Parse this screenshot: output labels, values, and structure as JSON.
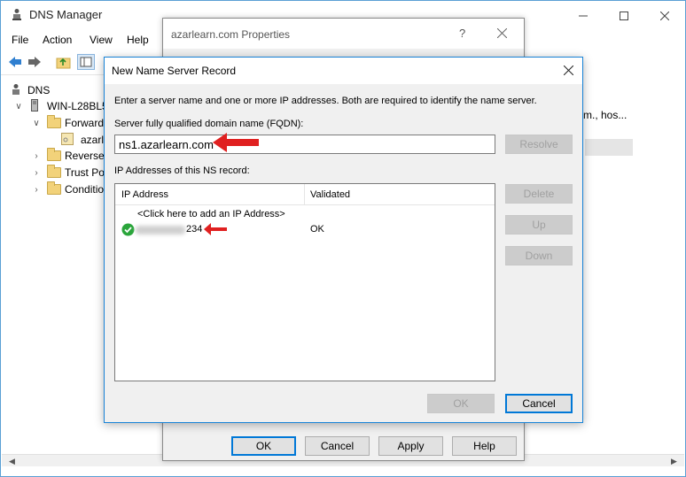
{
  "main_window": {
    "title": "DNS Manager",
    "menu": [
      "File",
      "Action",
      "View",
      "Help"
    ],
    "tree": {
      "root": "DNS",
      "server": "WIN-L28BL5",
      "forward": "Forward",
      "zone": "azarl",
      "reverse": "Reverse",
      "trust": "Trust Po",
      "conditional": "Conditio"
    },
    "right_pane_text": "m., hos..."
  },
  "properties_dialog": {
    "title": "azarlearn.com Properties",
    "help_glyph": "?",
    "buttons": {
      "ok": "OK",
      "cancel": "Cancel",
      "apply": "Apply",
      "help": "Help"
    }
  },
  "ns_dialog": {
    "title": "New Name Server Record",
    "instructions": "Enter a server name and one or more IP addresses.  Both are required to identify the name server.",
    "fqdn_label": "Server fully qualified domain name (FQDN):",
    "fqdn_value": "ns1.azarlearn.com",
    "resolve_label": "Resolve",
    "ip_list_label": "IP Addresses of this NS record:",
    "columns": {
      "ip": "IP Address",
      "validated": "Validated"
    },
    "add_prompt": "<Click here to add an IP Address>",
    "rows": [
      {
        "ip_suffix": "234",
        "validated": "OK"
      }
    ],
    "side_buttons": {
      "delete": "Delete",
      "up": "Up",
      "down": "Down"
    },
    "ok_label": "OK",
    "cancel_label": "Cancel"
  },
  "colors": {
    "accent": "#0078d7",
    "annotation_red": "#e02020",
    "ok_green": "#2aa53b"
  }
}
